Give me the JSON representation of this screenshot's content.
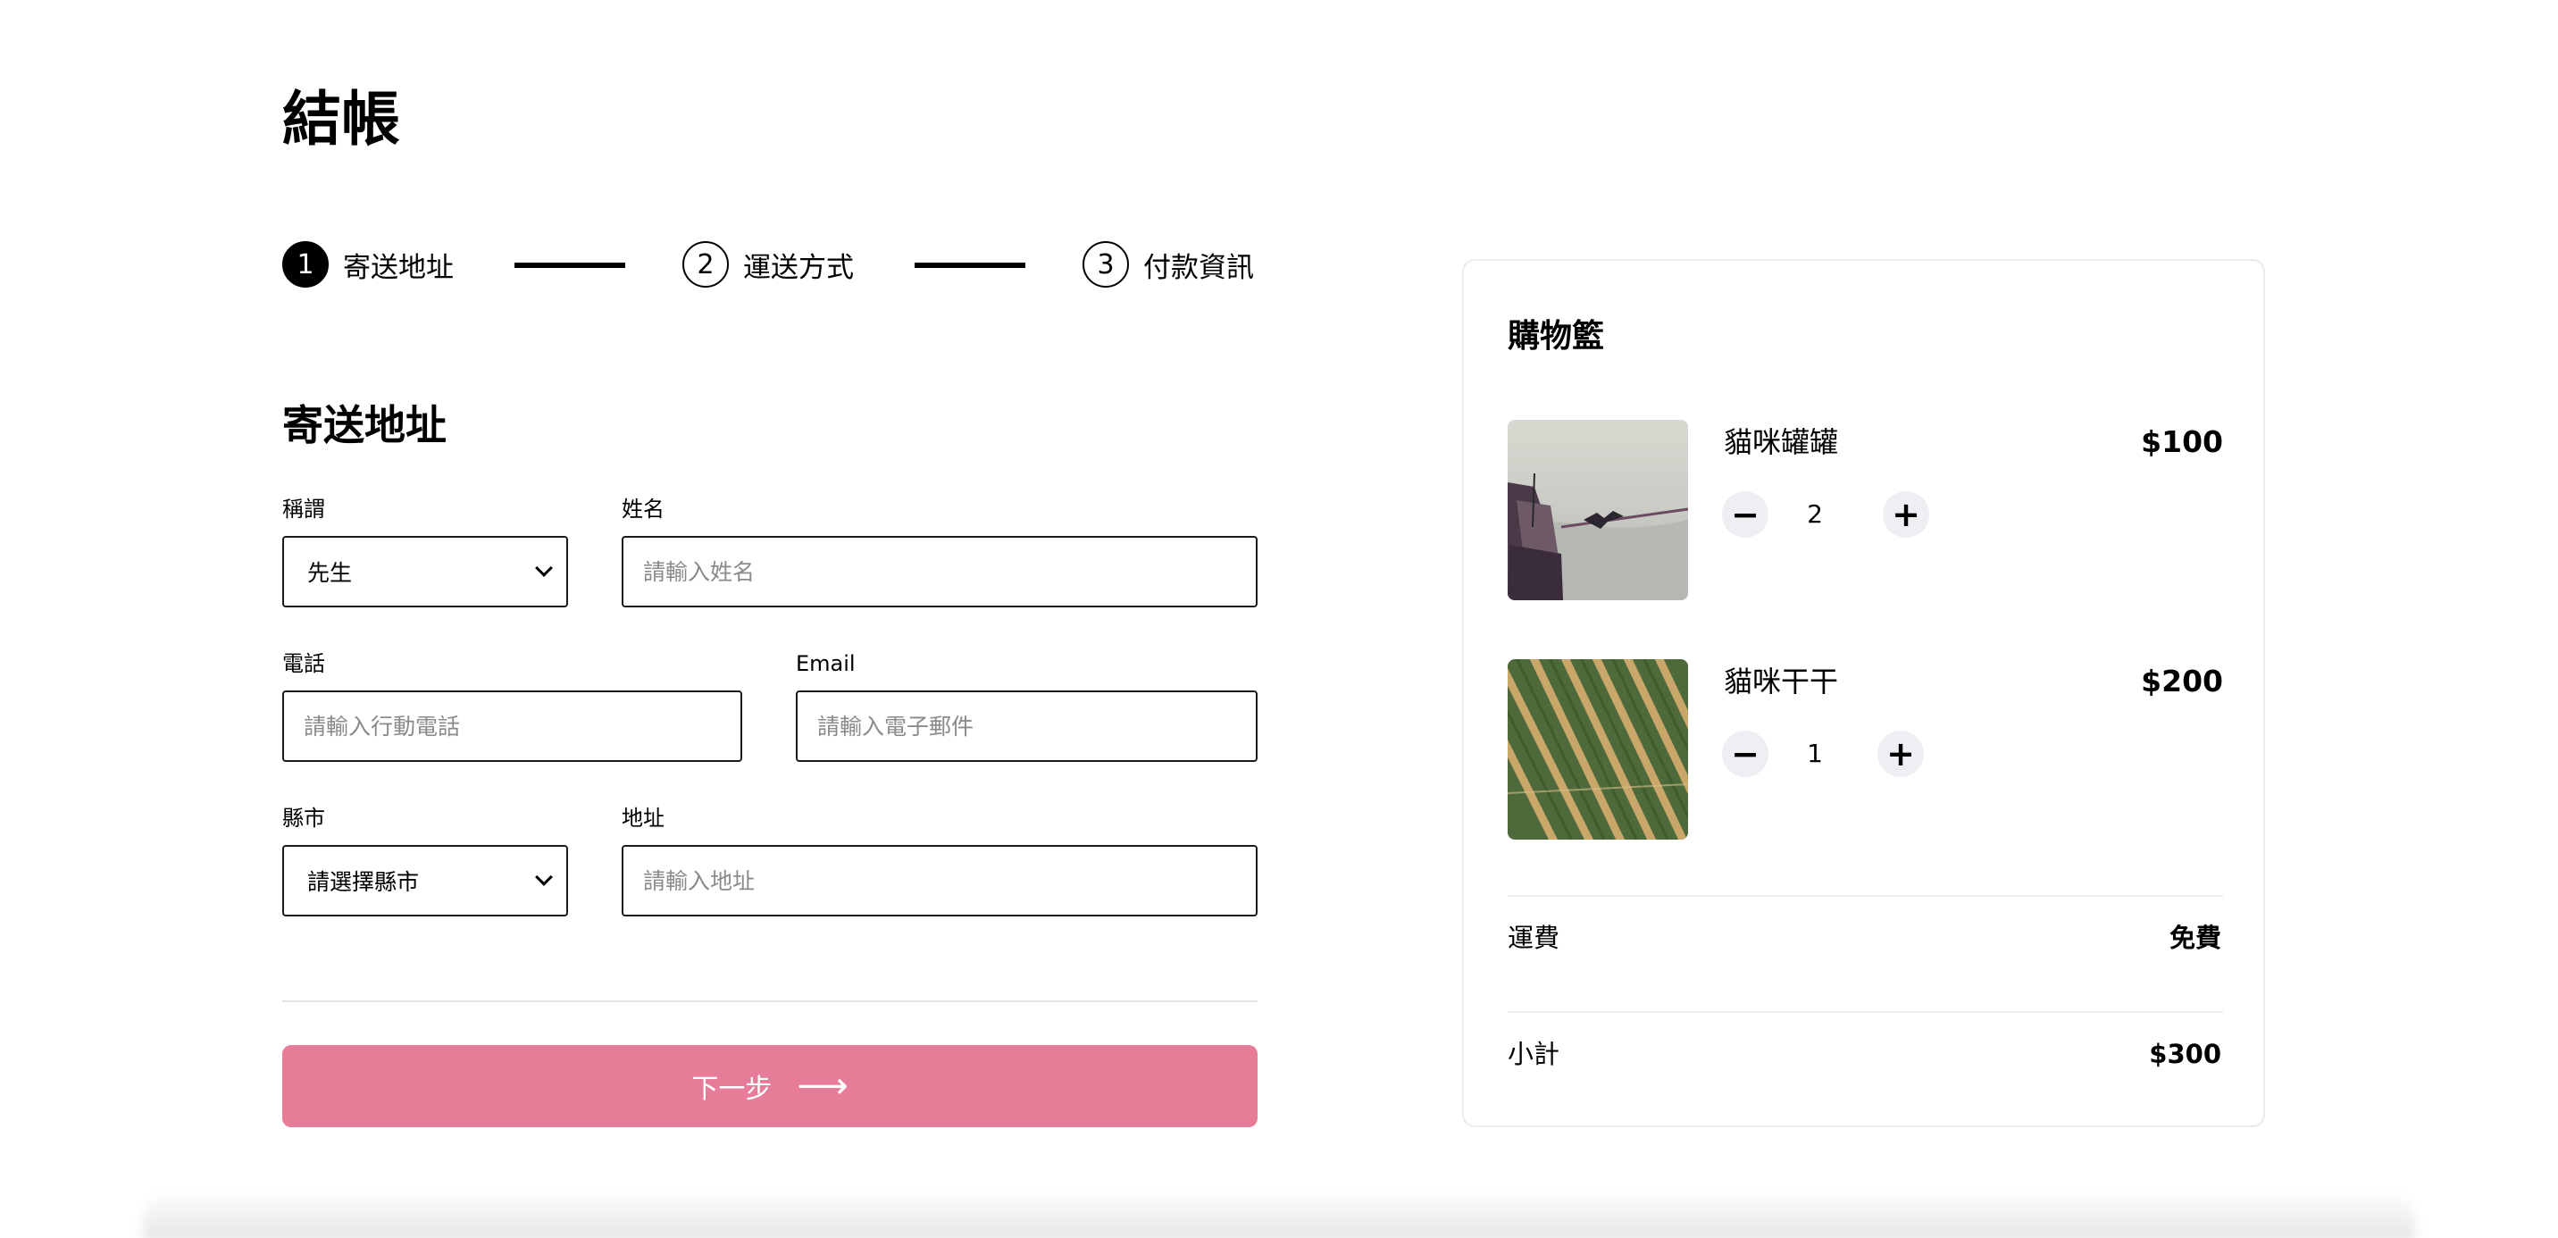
{
  "page": {
    "title": "結帳"
  },
  "stepper": {
    "steps": [
      {
        "number": "1",
        "label": "寄送地址",
        "active": true
      },
      {
        "number": "2",
        "label": "運送方式",
        "active": false
      },
      {
        "number": "3",
        "label": "付款資訊",
        "active": false
      }
    ]
  },
  "form": {
    "section_title": "寄送地址",
    "salutation": {
      "label": "稱謂",
      "value": "先生"
    },
    "name": {
      "label": "姓名",
      "placeholder": "請輸入姓名"
    },
    "phone": {
      "label": "電話",
      "placeholder": "請輸入行動電話"
    },
    "email": {
      "label": "Email",
      "placeholder": "請輸入電子郵件"
    },
    "city": {
      "label": "縣市",
      "value": "請選擇縣市"
    },
    "address": {
      "label": "地址",
      "placeholder": "請輸入地址"
    },
    "next_label": "下一步",
    "next_arrow": "⟶"
  },
  "cart": {
    "title": "購物籃",
    "items": [
      {
        "name": "貓咪罐罐",
        "price": "$100",
        "quantity": "2",
        "image": "seabird-on-boat-photo"
      },
      {
        "name": "貓咪干干",
        "price": "$200",
        "quantity": "1",
        "image": "aerial-crop-rows-photo"
      }
    ],
    "minus_symbol": "−",
    "plus_symbol": "+",
    "shipping_label": "運費",
    "shipping_value": "免費",
    "subtotal_label": "小計",
    "subtotal_value": "$300"
  },
  "colors": {
    "accent": "#e77c99",
    "border": "#1a1a1a",
    "qty_button_bg": "#efeef2"
  }
}
